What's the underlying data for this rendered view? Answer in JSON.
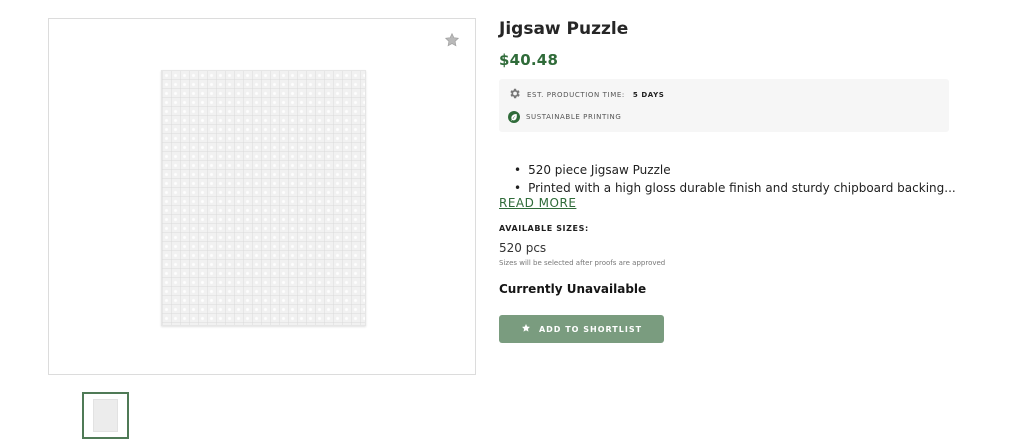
{
  "product": {
    "title": "Jigsaw Puzzle",
    "price": "$40.48"
  },
  "info": {
    "production_label": "EST. PRODUCTION TIME:",
    "production_value": "5 DAYS",
    "sustainable_label": "SUSTAINABLE PRINTING"
  },
  "description": {
    "bullets": [
      "520 piece Jigsaw Puzzle",
      "Printed with a high gloss durable finish and sturdy chipboard backing..."
    ],
    "read_more": "READ MORE"
  },
  "sizes": {
    "heading": "AVAILABLE SIZES:",
    "value": "520 pcs",
    "note": "Sizes will be selected after proofs are approved"
  },
  "availability": "Currently Unavailable",
  "actions": {
    "shortlist_label": "ADD TO SHORTLIST"
  },
  "icons": {
    "favorite": "star-icon",
    "production": "gear-icon",
    "sustainable": "leaf-icon",
    "shortlist": "star-icon"
  },
  "colors": {
    "accent": "#2f6b39",
    "button": "#7a9c7f",
    "info_bg": "#f6f6f6"
  }
}
